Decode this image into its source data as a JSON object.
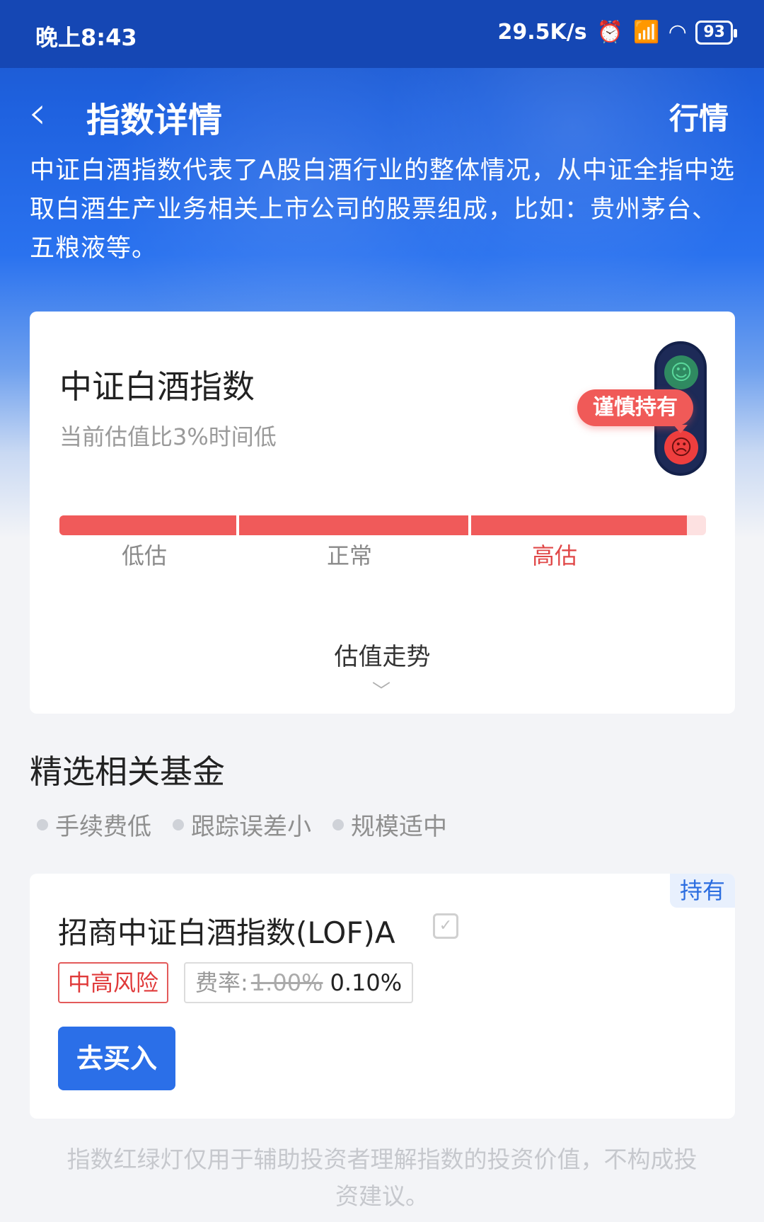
{
  "status_bar": {
    "time": "晚上8:43",
    "network_speed": "29.5K/s",
    "icons": [
      "alarm-icon",
      "hd-signal-icon",
      "wifi-icon"
    ],
    "battery": "93"
  },
  "nav": {
    "back_icon": "chevron-left-icon",
    "title": "指数详情",
    "right_label": "行情"
  },
  "intro": "中证白酒指数代表了A股白酒行业的整体情况，从中证全指中选取白酒生产业务相关上市公司的股票组成，比如：贵州茅台、五粮液等。",
  "valuation_card": {
    "index_name": "中证白酒指数",
    "subtitle": "当前估值比3%时间低",
    "signal_label": "谨慎持有",
    "signal_icons": [
      "smile-face-icon",
      "angry-face-icon"
    ],
    "gauge": {
      "level": 0.97,
      "labels": [
        "低估",
        "正常",
        "高估"
      ],
      "active_label": "高估"
    },
    "trend_label": "估值走势",
    "trend_icon": "chevron-down-icon"
  },
  "funds_section": {
    "title": "精选相关基金",
    "tags": [
      "手续费低",
      "跟踪误差小",
      "规模适中"
    ]
  },
  "fund_card": {
    "hold_badge": "持有",
    "name": "招商中证白酒指数(LOF)A",
    "checkbox_icon": "check-icon",
    "risk": "中高风险",
    "fee_label": "费率:",
    "fee_old": "1.00%",
    "fee_new": "0.10%",
    "buy_label": "去买入"
  },
  "disclaimer": "指数红绿灯仅用于辅助投资者理解指数的投资价值，不构成投资建议。",
  "colors": {
    "primary": "#2b6fe8",
    "header": "#1547b4",
    "danger": "#f05a5a",
    "muted": "#9a9a9a"
  }
}
